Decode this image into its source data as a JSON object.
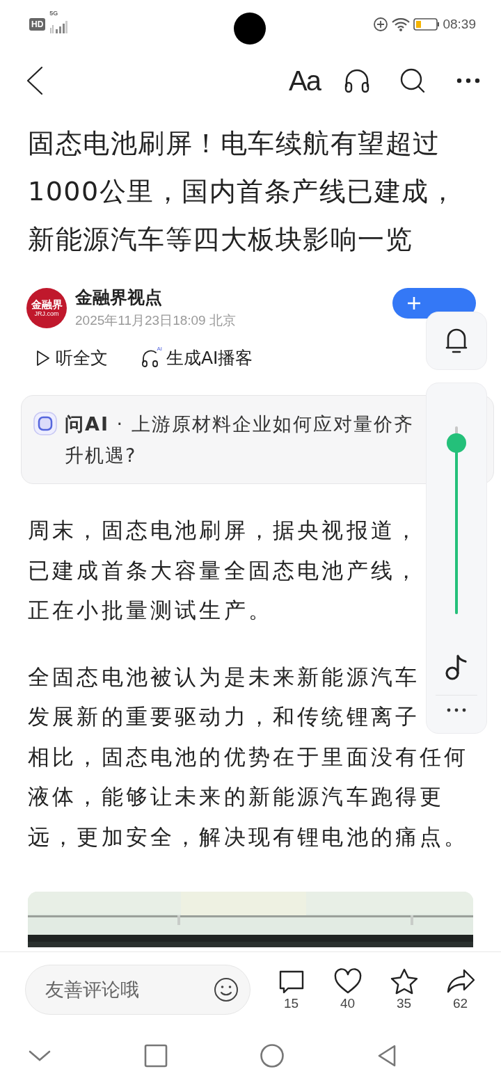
{
  "status_bar": {
    "hd": "HD",
    "network": "5G",
    "time": "08:39"
  },
  "toolbar": {
    "font_button": "Aa"
  },
  "article": {
    "title": "固态电池刷屏！电车续航有望超过1000公里，国内首条产线已建成，新能源汽车等四大板块影响一览",
    "author": {
      "name": "金融界视点",
      "logo_text": "金融界",
      "logo_subtext": "JRJ.com",
      "meta": "2025年11月23日18:09 北京"
    },
    "actions": [
      {
        "kind": "play",
        "label": "听全文"
      },
      {
        "kind": "podcast",
        "label": "生成AI播客",
        "badge": "AI"
      }
    ],
    "ask_ai": {
      "text": "**问AI** · 上游原材料企业如何应对量价齐升机遇?"
    },
    "paragraphs": [
      {
        "blocks": [
          {
            "kind": "beside_panel",
            "text": "周末，固态电池刷屏，据央视报道，已建成首条大容量全固态电池产线，正在小批量测试生产。"
          }
        ]
      },
      {
        "blocks": [
          {
            "kind": "beside_panel",
            "text": "全固态电池被认为是未来新能源汽车发展新的重要驱动力，和传统锂离子"
          },
          {
            "kind": "full",
            "text": "相比，固态电池的优势在于里面没有任何液体，能够让未来的新能源汽车跑得更远，更加安全，解决现有锂电池的痛点。"
          }
        ]
      }
    ]
  },
  "volume_panel": {
    "level": 0.91
  },
  "comment_bar": {
    "placeholder": "友善评论哦",
    "stats": [
      {
        "kind": "comment",
        "count": "15"
      },
      {
        "kind": "like",
        "count": "40"
      },
      {
        "kind": "favorite",
        "count": "35"
      },
      {
        "kind": "share",
        "count": "62"
      }
    ]
  }
}
